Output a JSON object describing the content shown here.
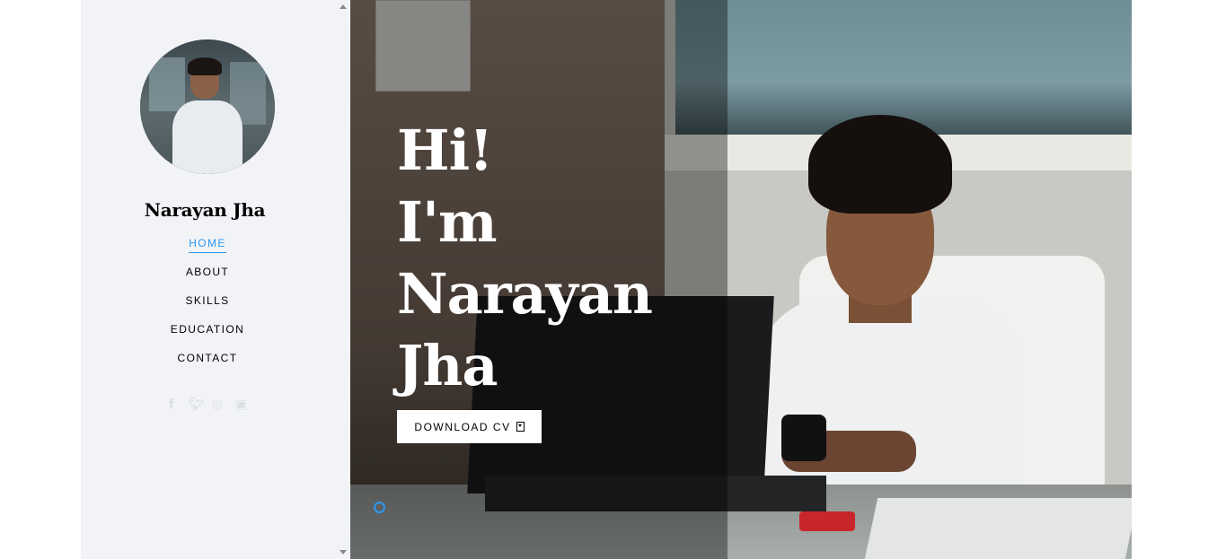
{
  "sidebar": {
    "name": "Narayan Jha",
    "nav": [
      {
        "label": "HOME",
        "active": true
      },
      {
        "label": "ABOUT",
        "active": false
      },
      {
        "label": "SKILLS",
        "active": false
      },
      {
        "label": "EDUCATION",
        "active": false
      },
      {
        "label": "CONTACT",
        "active": false
      }
    ],
    "social_icons": [
      "facebook-icon",
      "twitter-icon",
      "instagram-icon",
      "linkedin-icon"
    ]
  },
  "hero": {
    "headline_lines": [
      "Hi!",
      "I'm",
      "Narayan",
      "Jha"
    ],
    "cta_label": "DOWNLOAD CV",
    "cta_icon": "download-file-icon"
  },
  "colors": {
    "accent": "#2c98f0",
    "sidebar_bg": "#f2f3f7",
    "text": "#000000"
  }
}
